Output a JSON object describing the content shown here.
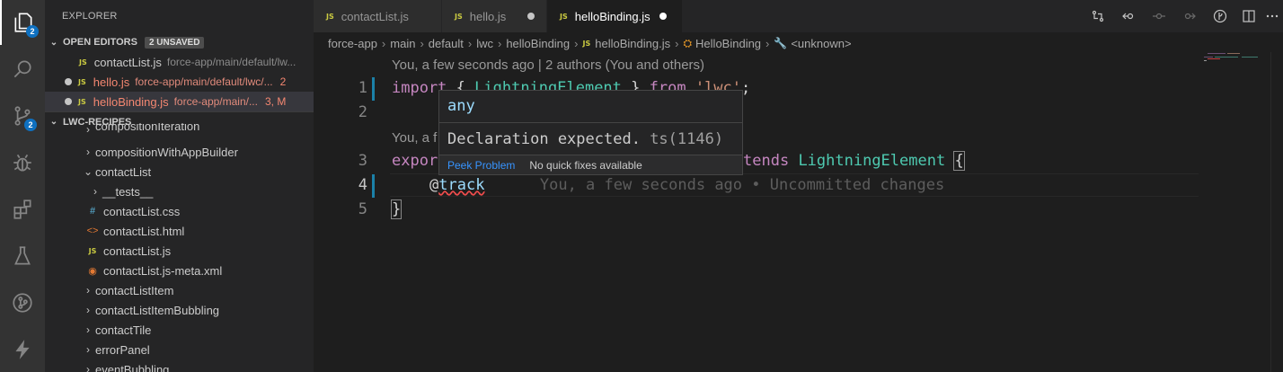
{
  "activity_bar": {
    "explorer_badge": "2",
    "scm_badge": "2",
    "items": [
      "explorer-icon",
      "search-icon",
      "source-control-icon",
      "debug-icon",
      "extensions-icon",
      "testing-icon",
      "git-graph-icon",
      "salesforce-icon"
    ]
  },
  "sidebar": {
    "title": "EXPLORER",
    "open_editors": {
      "label": "OPEN EDITORS",
      "unsaved_badge": "2 UNSAVED",
      "items": [
        {
          "name": "contactList.js",
          "path": "force-app/main/default/lw..."
        },
        {
          "name": "hello.js",
          "path": "force-app/main/default/lwc/...",
          "errors": "2"
        },
        {
          "name": "helloBinding.js",
          "path": "force-app/main/...",
          "errors": "3,",
          "mod": "M"
        }
      ]
    },
    "workspace": {
      "label": "LWC-RECIPES",
      "items": [
        "compositionIteration",
        "compositionWithAppBuilder",
        "contactList",
        "__tests__",
        "contactList.css",
        "contactList.html",
        "contactList.js",
        "contactList.js-meta.xml",
        "contactListItem",
        "contactListItemBubbling",
        "contactTile",
        "errorPanel",
        "eventBubbling"
      ]
    }
  },
  "tabs": [
    {
      "label": "contactList.js",
      "modified": false
    },
    {
      "label": "hello.js",
      "modified": true
    },
    {
      "label": "helloBinding.js",
      "modified": true,
      "active": true
    }
  ],
  "breadcrumb": [
    "force-app",
    "main",
    "default",
    "lwc",
    "helloBinding",
    "helloBinding.js",
    "HelloBinding",
    "<unknown>"
  ],
  "editor": {
    "codelens_top": "You, a few seconds ago | 2 authors (You and others)",
    "codelens_mid": "You, a f",
    "line_numbers": [
      "1",
      "2",
      "3",
      "4",
      "5"
    ],
    "line1": {
      "kw1": "import",
      "p1": " { ",
      "cls": "LightningElement",
      "p2": " } ",
      "kw2": "from",
      "sp": " ",
      "str": "'lwc'",
      "end": ";"
    },
    "line3": {
      "kw": "expor",
      "rest_kw": "tends",
      "cls": "LightningElement",
      "brace": "{"
    },
    "line4": {
      "at": "@",
      "dec": "track",
      "blame": "You, a few seconds ago • Uncommitted changes"
    },
    "line5": {
      "brace": "}"
    }
  },
  "hover": {
    "type": "any",
    "message": "Declaration expected.",
    "code": "ts(1146)",
    "peek": "Peek Problem",
    "no_fix": "No quick fixes available"
  },
  "colors": {
    "keyword": "#c586c0",
    "class": "#4ec9b0",
    "string": "#ce9178",
    "decorator": "#9cdcfe",
    "error": "#f48771",
    "badge": "#0e70c0"
  }
}
